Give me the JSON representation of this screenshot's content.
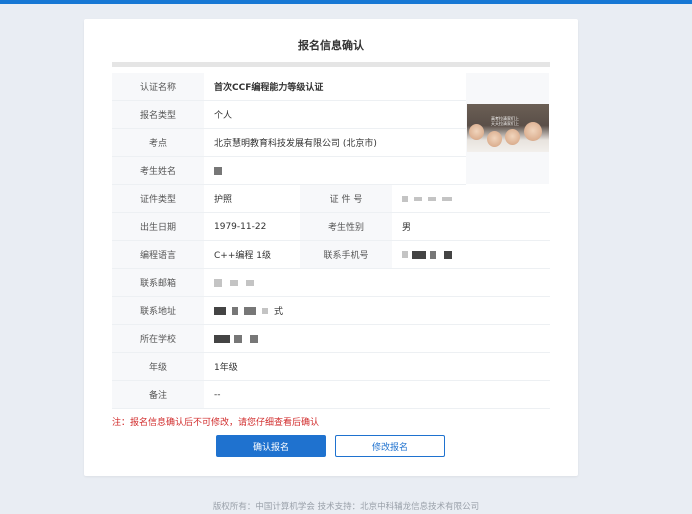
{
  "page": {
    "title": "报名信息确认"
  },
  "form": {
    "cert_name": {
      "label": "认证名称",
      "value": "首次CCF编程能力等级认证"
    },
    "reg_type": {
      "label": "报名类型",
      "value": "个人"
    },
    "exam_site": {
      "label": "考点",
      "value": "北京慧明教育科技发展有限公司 (北京市)"
    },
    "candidate_name": {
      "label": "考生姓名"
    },
    "id_type": {
      "label": "证件类型",
      "value": "护照"
    },
    "id_number": {
      "label": "证 件 号"
    },
    "birth_date": {
      "label": "出生日期",
      "value": "1979-11-22"
    },
    "gender": {
      "label": "考生性别",
      "value": "男"
    },
    "language": {
      "label": "编程语言",
      "value": "C++编程 1级"
    },
    "phone": {
      "label": "联系手机号"
    },
    "email": {
      "label": "联系邮箱"
    },
    "address": {
      "label": "联系地址",
      "suffix": "式"
    },
    "school": {
      "label": "所在学校"
    },
    "grade": {
      "label": "年级",
      "value": "1年级"
    },
    "remark": {
      "label": "备注",
      "value": "--"
    }
  },
  "photo": {
    "alt_text_lines": [
      "高考拉清家们上",
      "天天拉清家们上"
    ]
  },
  "note": "注：报名信息确认后不可修改，请您仔细查看后确认",
  "buttons": {
    "confirm": "确认报名",
    "modify": "修改报名"
  },
  "footer": "版权所有：中国计算机学会  技术支持：北京中科辅龙信息技术有限公司",
  "colors": {
    "primary": "#1f72cf",
    "note": "#d12b2b",
    "topbar": "#1677d4"
  }
}
